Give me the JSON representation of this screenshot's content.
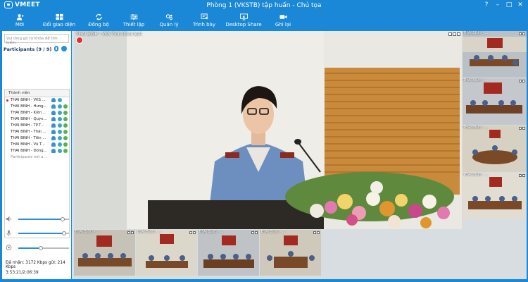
{
  "app": {
    "logo_text": "VMEET",
    "window_title": "Phòng 1 (VKSTB) tập huấn - Chủ tọa",
    "window_controls": [
      "?",
      "–",
      "□",
      "✕"
    ]
  },
  "toolbar": [
    {
      "label": "Mời",
      "icon": "invite-person-icon"
    },
    {
      "label": "Đổi giao diện",
      "icon": "layout-icon"
    },
    {
      "label": "Đồng bộ",
      "icon": "sync-icon"
    },
    {
      "label": "Thiết lập",
      "icon": "settings-sliders-icon"
    },
    {
      "label": "Quản lý",
      "icon": "manage-icon"
    },
    {
      "label": "Trình bày",
      "icon": "present-icon"
    },
    {
      "label": "Desktop Share",
      "icon": "desktop-share-icon"
    },
    {
      "label": "Ghi lại",
      "icon": "record-icon"
    }
  ],
  "sidebar": {
    "search_placeholder": "Vui lòng gõ từ khóa để tìm kiếm",
    "participants_label": "Participants (9 / 9)",
    "column_header": "Thành viên",
    "participants": [
      "THÁI BÌNH - VKS ...",
      "THÁI BÌNH - Hưng...",
      "THÁI BÌNH - Kiến ...",
      "THÁI BÌNH - Quỳn...",
      "THÁI BÌNH - TP.T...",
      "THÁI BÌNH - Thái ...",
      "THÁI BÌNH - Tiền ...",
      "THÁI BÌNH - Vũ T...",
      "THÁI BÌNH - Đông..."
    ],
    "participants_note": "Participants not a...",
    "volume_speaker": 0.88,
    "volume_mic": 0.9,
    "volume_camera": 0.45,
    "stats_text": "Đã nhận: 3172 Kbps gửi: 214 Kbps",
    "duration_text": "3:53:21/2:06:39"
  },
  "main_video": {
    "label": "THÁI BÌNH - VKS Tỉnh (Chủ tọa)"
  },
  "side_thumbs": [
    {
      "label": "THÁI BÌNH - ..."
    },
    {
      "label": "THÁI BÌNH - ..."
    },
    {
      "label": "THÁI BÌNH - ..."
    },
    {
      "label": "THÁI BÌNH - ..."
    }
  ],
  "bottom_thumbs": [
    {
      "label": "THÁI BÌNH - ..."
    },
    {
      "label": "THÁI BÌNH - ..."
    },
    {
      "label": "THÁI BÌNH - ..."
    },
    {
      "label": "THÁI BÌNH - ..."
    }
  ],
  "colors": {
    "brand": "#1a88d6",
    "accent": "#2a8ed8"
  }
}
